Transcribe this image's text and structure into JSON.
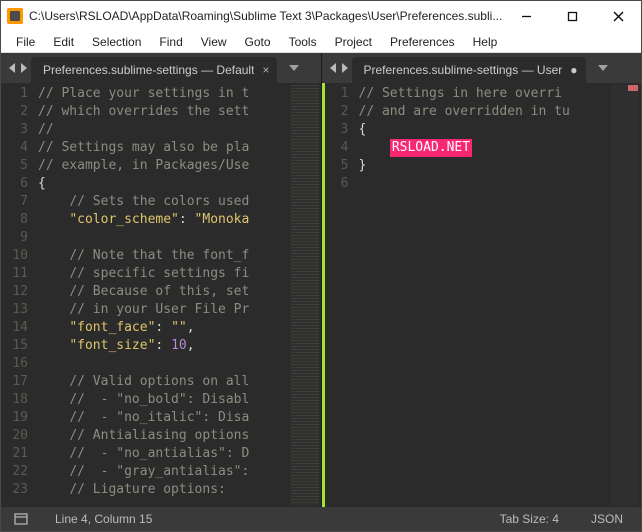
{
  "window": {
    "title": "C:\\Users\\RSLOAD\\AppData\\Roaming\\Sublime Text 3\\Packages\\User\\Preferences.subli..."
  },
  "menu": [
    "File",
    "Edit",
    "Selection",
    "Find",
    "View",
    "Goto",
    "Tools",
    "Project",
    "Preferences",
    "Help"
  ],
  "panes": {
    "left": {
      "tab": "Preferences.sublime-settings — Default",
      "lines": [
        {
          "n": 1,
          "seg": [
            [
              "cm",
              "// Place your settings in t"
            ]
          ]
        },
        {
          "n": 2,
          "seg": [
            [
              "cm",
              "// which overrides the sett"
            ]
          ]
        },
        {
          "n": 3,
          "seg": [
            [
              "cm",
              "//"
            ]
          ]
        },
        {
          "n": 4,
          "seg": [
            [
              "cm",
              "// Settings may also be pla"
            ]
          ]
        },
        {
          "n": 5,
          "seg": [
            [
              "cm",
              "// example, in Packages/Use"
            ]
          ]
        },
        {
          "n": 6,
          "seg": [
            [
              "pl",
              "{"
            ]
          ]
        },
        {
          "n": 7,
          "seg": [
            [
              "pl",
              "    "
            ],
            [
              "cm",
              "// Sets the colors used"
            ]
          ]
        },
        {
          "n": 8,
          "seg": [
            [
              "pl",
              "    "
            ],
            [
              "st",
              "\"color_scheme\""
            ],
            [
              "pl",
              ": "
            ],
            [
              "st",
              "\"Monoka"
            ]
          ]
        },
        {
          "n": 9,
          "seg": [
            [
              "pl",
              " "
            ]
          ]
        },
        {
          "n": 10,
          "seg": [
            [
              "pl",
              "    "
            ],
            [
              "cm",
              "// Note that the font_f"
            ]
          ]
        },
        {
          "n": 11,
          "seg": [
            [
              "pl",
              "    "
            ],
            [
              "cm",
              "// specific settings fi"
            ]
          ]
        },
        {
          "n": 12,
          "seg": [
            [
              "pl",
              "    "
            ],
            [
              "cm",
              "// Because of this, set"
            ]
          ]
        },
        {
          "n": 13,
          "seg": [
            [
              "pl",
              "    "
            ],
            [
              "cm",
              "// in your User File Pr"
            ]
          ]
        },
        {
          "n": 14,
          "seg": [
            [
              "pl",
              "    "
            ],
            [
              "st",
              "\"font_face\""
            ],
            [
              "pl",
              ": "
            ],
            [
              "st",
              "\"\""
            ],
            [
              "pl",
              ","
            ]
          ]
        },
        {
          "n": 15,
          "seg": [
            [
              "pl",
              "    "
            ],
            [
              "st",
              "\"font_size\""
            ],
            [
              "pl",
              ": "
            ],
            [
              "num",
              "10"
            ],
            [
              "pl",
              ","
            ]
          ]
        },
        {
          "n": 16,
          "seg": [
            [
              "pl",
              " "
            ]
          ]
        },
        {
          "n": 17,
          "seg": [
            [
              "pl",
              "    "
            ],
            [
              "cm",
              "// Valid options on all"
            ]
          ]
        },
        {
          "n": 18,
          "seg": [
            [
              "pl",
              "    "
            ],
            [
              "cm",
              "//  - \"no_bold\": Disabl"
            ]
          ]
        },
        {
          "n": 19,
          "seg": [
            [
              "pl",
              "    "
            ],
            [
              "cm",
              "//  - \"no_italic\": Disa"
            ]
          ]
        },
        {
          "n": 20,
          "seg": [
            [
              "pl",
              "    "
            ],
            [
              "cm",
              "// Antialiasing options"
            ]
          ]
        },
        {
          "n": 21,
          "seg": [
            [
              "pl",
              "    "
            ],
            [
              "cm",
              "//  - \"no_antialias\": D"
            ]
          ]
        },
        {
          "n": 22,
          "seg": [
            [
              "pl",
              "    "
            ],
            [
              "cm",
              "//  - \"gray_antialias\":"
            ]
          ]
        },
        {
          "n": 23,
          "seg": [
            [
              "pl",
              "    "
            ],
            [
              "cm",
              "// Ligature options:"
            ]
          ]
        }
      ]
    },
    "right": {
      "tab": "Preferences.sublime-settings — User",
      "lines": [
        {
          "n": 1,
          "seg": [
            [
              "cm",
              "// Settings in here overri"
            ]
          ]
        },
        {
          "n": 2,
          "seg": [
            [
              "cm",
              "// and are overridden in tu"
            ]
          ]
        },
        {
          "n": 3,
          "seg": [
            [
              "pl",
              "{"
            ]
          ]
        },
        {
          "n": 4,
          "seg": [
            [
              "pl",
              "    "
            ],
            [
              "hl",
              "RSLOAD.NET"
            ]
          ]
        },
        {
          "n": 5,
          "seg": [
            [
              "pl",
              "}"
            ]
          ]
        },
        {
          "n": 6,
          "seg": [
            [
              "pl",
              " "
            ]
          ]
        }
      ]
    }
  },
  "status": {
    "cursor": "Line 4, Column 15",
    "tabsize": "Tab Size: 4",
    "syntax": "JSON"
  }
}
